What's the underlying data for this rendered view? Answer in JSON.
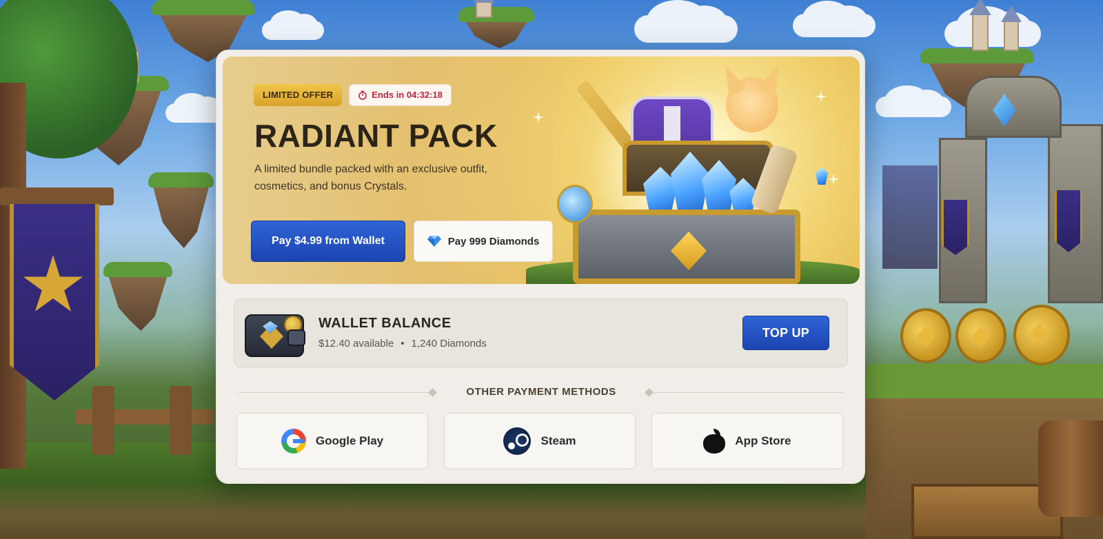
{
  "offer": {
    "badge": "LIMITED OFFER",
    "timer_label": "Ends in 04:32:18",
    "title": "RADIANT PACK",
    "description": "A limited bundle packed with an exclusive outfit, cosmetics, and bonus Crystals.",
    "pay_wallet_label": "Pay $4.99 from Wallet",
    "pay_diamonds_label": "Pay 999 Diamonds"
  },
  "wallet": {
    "title": "WALLET BALANCE",
    "available": "$12.40 available",
    "separator": "•",
    "diamonds": "1,240 Diamonds",
    "topup_label": "TOP UP"
  },
  "other_methods": {
    "heading": "OTHER PAYMENT METHODS",
    "items": [
      {
        "label": "Google Play",
        "icon": "google-play-icon"
      },
      {
        "label": "Steam",
        "icon": "steam-icon"
      },
      {
        "label": "App Store",
        "icon": "apple-icon"
      }
    ]
  },
  "colors": {
    "primary_blue": "#2453c4",
    "gold": "#e3b23c",
    "timer_red": "#c0243a",
    "card_bg": "#f1eeea"
  }
}
